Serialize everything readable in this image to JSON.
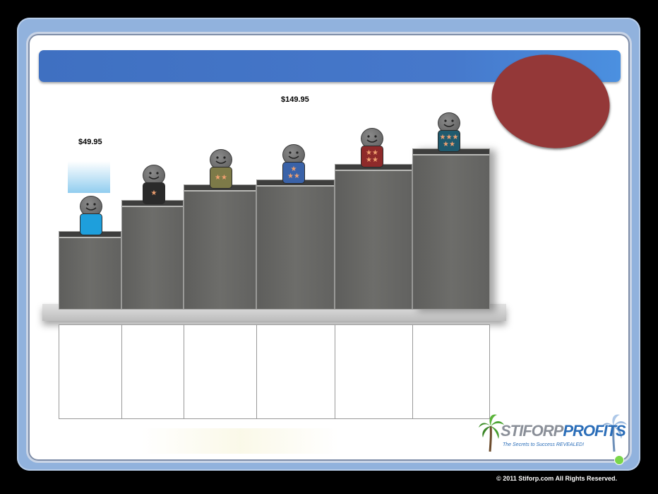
{
  "prices": {
    "low": "$49.95",
    "mid": "$149.95"
  },
  "steps": [
    {
      "badge": "",
      "color": "#1e9fdc"
    },
    {
      "badge": "★",
      "color": "#2a2a2a"
    },
    {
      "badge": "★★",
      "color": "#7d7a48"
    },
    {
      "badge": "★|★★",
      "color": "#3a62a8"
    },
    {
      "badge": "★★|★★",
      "color": "#8e2a2a"
    },
    {
      "badge": "★★★|★★",
      "color": "#1f5a6e"
    }
  ],
  "logo": {
    "brand_left": "STIFORP",
    "brand_right": "PROFITS",
    "tagline": "The Secrets to Success REVEALED!"
  },
  "footer": {
    "copyright": "© 2011 Stiforp.com All Rights Reserved."
  }
}
